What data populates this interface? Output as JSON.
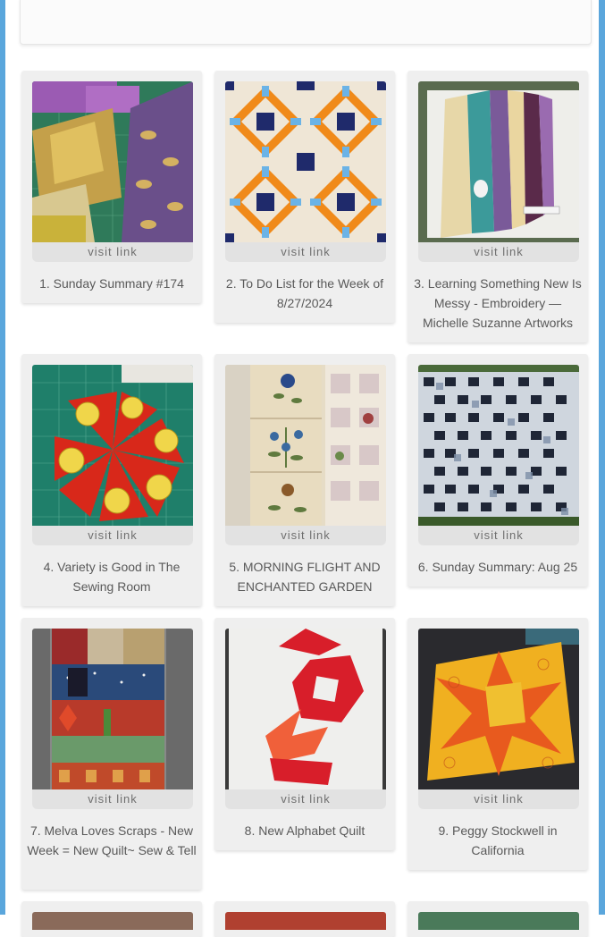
{
  "links": [
    {
      "title": "1. Sunday Summary #174",
      "visit_label": "visit link"
    },
    {
      "title": "2. To Do List for the Week of 8/27/2024",
      "visit_label": "visit link"
    },
    {
      "title": "3. Learning Something New Is Messy - Embroidery — Michelle Suzanne Artworks",
      "visit_label": "visit link"
    },
    {
      "title": "4. Variety is Good in The Sewing Room",
      "visit_label": "visit link"
    },
    {
      "title": "5. MORNING FLIGHT AND ENCHANTED GARDEN",
      "visit_label": "visit link"
    },
    {
      "title": "6. Sunday Summary: Aug 25",
      "visit_label": "visit link"
    },
    {
      "title": "7. Melva Loves Scraps - New Week = New Quilt~ Sew & Tell",
      "visit_label": "visit link"
    },
    {
      "title": "8. New Alphabet Quilt",
      "visit_label": "visit link"
    },
    {
      "title": "9. Peggy Stockwell in California",
      "visit_label": "visit link"
    }
  ],
  "colors": {
    "frame": "#5aa6dc",
    "card_bg": "#efefef",
    "visit_bar": "#e2e2e2",
    "text": "#595959"
  }
}
